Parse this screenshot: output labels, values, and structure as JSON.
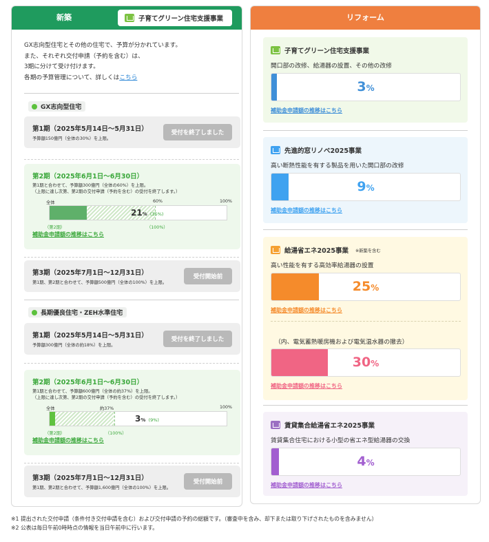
{
  "left": {
    "title": "新築",
    "tab_label": "子育てグリーン住宅支援事業",
    "intro": [
      "GX志向型住宅とその他の住宅で、予算が分かれています。",
      "また、それぞれ交付申請（予約を含む）は、",
      "3期に分けて受け付けます。"
    ],
    "intro_last_prefix": "各期の予算管理について、詳しくは",
    "intro_link": "こちら",
    "groups": [
      {
        "label": "GX志向型住宅",
        "phase1": {
          "title": "第1期（2025年5月14日〜5月31日）",
          "sub": "予算額150億円（全体の30%）を上限。",
          "button": "受付を終了しました"
        },
        "phase2": {
          "title": "第2期（2025年6月1日〜6月30日）",
          "sub1": "第1期と合わせて、予算額300億円（全体の60%）を上限。",
          "sub2": "（上限に達し次第、第2期の交付申請（予約を含む）の受付を終了します。）",
          "label_left": "全体",
          "label_mid": "60%",
          "label_right": "100%",
          "value": "21",
          "unit": "%",
          "overall": "(35%)",
          "under_left": "（第2期）",
          "under_mid": "（100%）",
          "link": "補助金申請額の推移はこちら",
          "progress_pct": 21,
          "threshold_pct": 60
        },
        "phase3": {
          "title": "第3期（2025年7月1日〜12月31日）",
          "sub": "第1期、第2期と合わせて、予算額500億円（全体の100%）を上限。",
          "button": "受付開始前"
        }
      },
      {
        "label": "長期優良住宅・ZEH水準住宅",
        "phase1": {
          "title": "第1期（2025年5月14日〜5月31日）",
          "sub": "予算額300億円（全体の約18%）を上限。",
          "button": "受付を終了しました"
        },
        "phase2": {
          "title": "第2期（2025年6月1日〜6月30日）",
          "sub1": "第1期と合わせて、予算額600億円（全体の約37%）を上限。",
          "sub2": "（上限に達し次第、第2期の交付申請（予約を含む）の受付を終了します。）",
          "label_left": "全体",
          "label_mid": "約37%",
          "label_right": "100%",
          "value": "3",
          "unit": "%",
          "overall": "(9%)",
          "under_left": "（第2期）",
          "under_mid": "（100%）",
          "link": "補助金申請額の推移はこちら",
          "progress_pct": 3,
          "threshold_pct": 37
        },
        "phase3": {
          "title": "第3期（2025年7月1日〜12月31日）",
          "sub": "第1期、第2期と合わせて、予算額1,600億円（全体の100%）を上限。",
          "button": "受付開始前"
        }
      }
    ]
  },
  "right": {
    "title": "リフォーム",
    "cards": [
      {
        "title": "子育てグリーン住宅支援事業",
        "note": "",
        "desc": "開口部の改修、給湯器の設置、その他の改修",
        "value": "3",
        "unit": "%",
        "progress_pct": 3,
        "link": "補助金申請額の推移はこちら",
        "color": "#3f8fd8",
        "bg": "#f1f9e9",
        "icon_color": "#7cc242"
      },
      {
        "title": "先進的窓リノベ2025事業",
        "note": "",
        "desc": "高い断熱性能を有する製品を用いた開口部の改修",
        "value": "9",
        "unit": "%",
        "progress_pct": 9,
        "link": "補助金申請額の推移はこちら",
        "color": "#3fa2f0",
        "bg": "#edf6fc",
        "icon_color": "#3fa2f0"
      },
      {
        "title": "給湯省エネ2025事業",
        "note": "※新築を含む",
        "desc": "高い性能を有する高効率給湯器の設置",
        "value": "25",
        "unit": "%",
        "progress_pct": 25,
        "link": "補助金申請額の推移はこちら",
        "color": "#f58b2b",
        "bg": "#fff9e2",
        "icon_color": "#f5a030"
      },
      {
        "title": "",
        "note": "",
        "desc": "（内、電気蓄熱暖房機および電気温水器の撤去）",
        "value": "30",
        "unit": "%",
        "progress_pct": 30,
        "link": "補助金申請額の推移はこちら",
        "color": "#f06584",
        "bg": "#fff9e2",
        "icon_color": ""
      },
      {
        "title": "賃貸集合給湯省エネ2025事業",
        "note": "",
        "desc": "賃貸集合住宅における小型の省エネ型給湯器の交換",
        "value": "4",
        "unit": "%",
        "progress_pct": 4,
        "link": "補助金申請額の推移はこちら",
        "color": "#a25fd0",
        "bg": "#f6f1f9",
        "icon_color": "#9b6fc2"
      }
    ]
  },
  "notes": [
    "※1  提出された交付申請（条件付き交付申請を含む）および交付申請の予約の総額です。（審査中を含み、却下または取り下げされたものを含みません）",
    "※2  公表は毎日午前0時時点の情報を当日午前中に行います。"
  ]
}
